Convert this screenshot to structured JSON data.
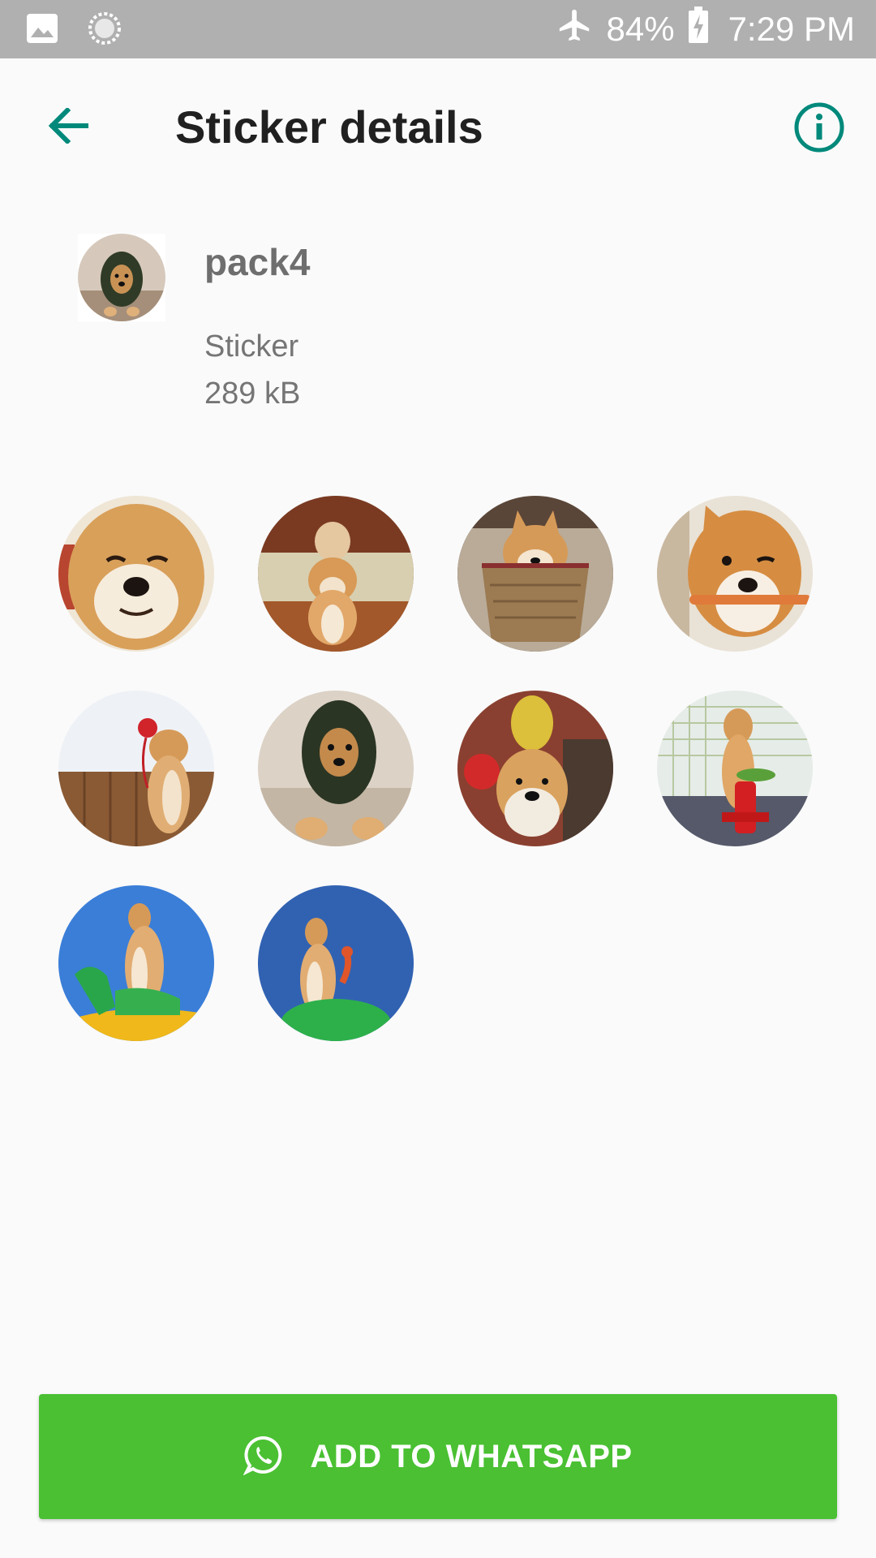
{
  "status_bar": {
    "icons": [
      "image-icon",
      "sync-icon",
      "airplane-icon",
      "battery-charging-icon"
    ],
    "battery": "84%",
    "time": "7:29 PM"
  },
  "toolbar": {
    "title": "Sticker details",
    "back_icon": "arrow-back-icon",
    "info_icon": "info-icon"
  },
  "pack": {
    "name": "pack4",
    "type": "Sticker",
    "size": "289 kB"
  },
  "stickers": [
    {
      "name": "sticker-1"
    },
    {
      "name": "sticker-2"
    },
    {
      "name": "sticker-3"
    },
    {
      "name": "sticker-4"
    },
    {
      "name": "sticker-5"
    },
    {
      "name": "sticker-6"
    },
    {
      "name": "sticker-7"
    },
    {
      "name": "sticker-8"
    },
    {
      "name": "sticker-9"
    },
    {
      "name": "sticker-10"
    }
  ],
  "actions": {
    "add_label": "ADD TO WHATSAPP",
    "add_icon": "whatsapp-icon"
  },
  "colors": {
    "accent": "#00897b",
    "button": "#4ac032",
    "status_bar": "#b0b0b0"
  }
}
